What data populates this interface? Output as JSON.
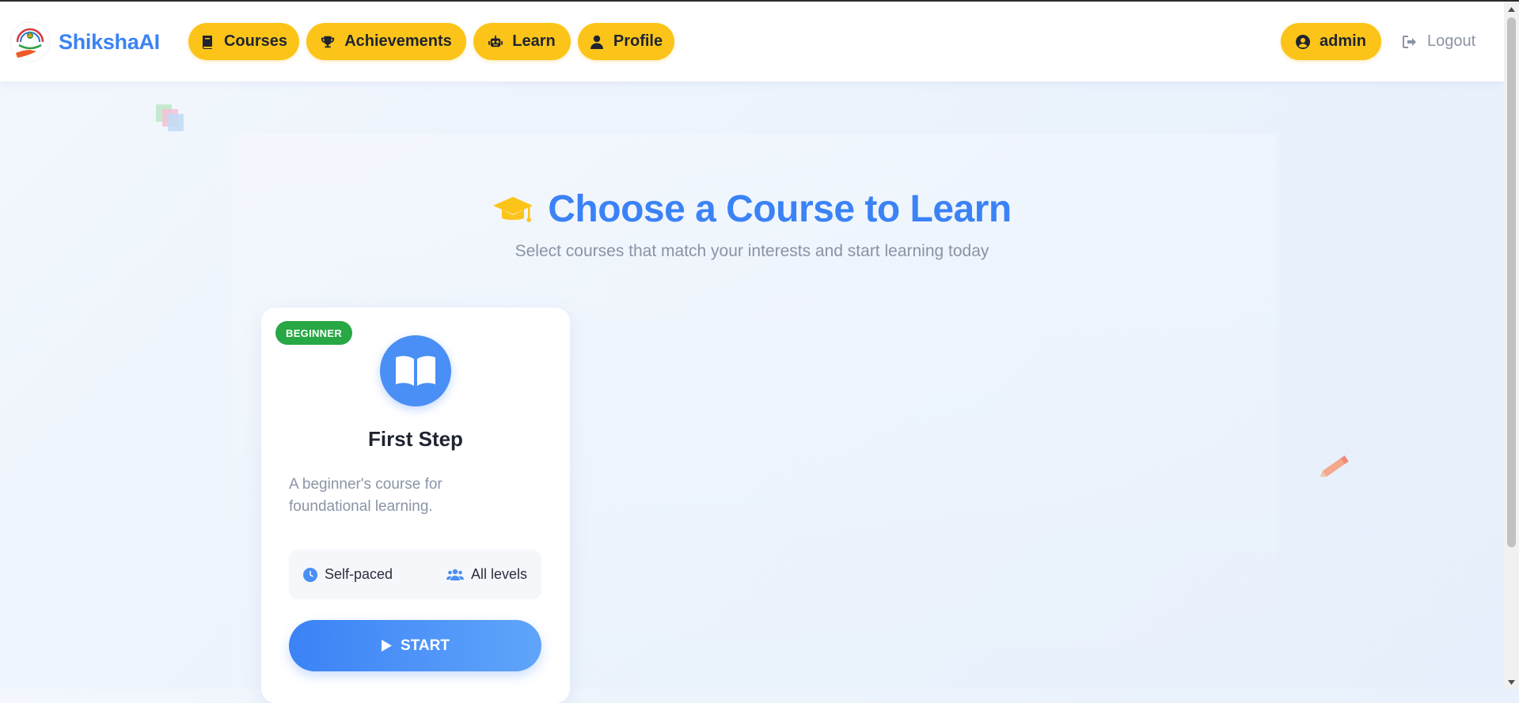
{
  "brand": {
    "name": "ShikshaAI"
  },
  "nav": {
    "items": [
      {
        "label": "Courses",
        "icon": "book-icon"
      },
      {
        "label": "Achievements",
        "icon": "trophy-icon"
      },
      {
        "label": "Learn",
        "icon": "robot-icon"
      },
      {
        "label": "Profile",
        "icon": "user-icon"
      }
    ],
    "user": {
      "label": "admin",
      "icon": "user-circle-icon"
    },
    "logout": {
      "label": "Logout",
      "icon": "sign-out-icon"
    }
  },
  "header": {
    "title": "Choose a Course to Learn",
    "icon": "graduation-cap-icon",
    "subtitle": "Select courses that match your interests and start learning today"
  },
  "courses": [
    {
      "badge": "BEGINNER",
      "icon": "open-book-icon",
      "title": "First Step",
      "description": "A beginner's course for foundational learning.",
      "pace": "Self-paced",
      "level": "All levels",
      "button": "START"
    }
  ],
  "colors": {
    "accent": "#3b82f6",
    "nav_pill": "#fcc419",
    "badge": "#28a745",
    "muted_text": "#8a94a6"
  }
}
